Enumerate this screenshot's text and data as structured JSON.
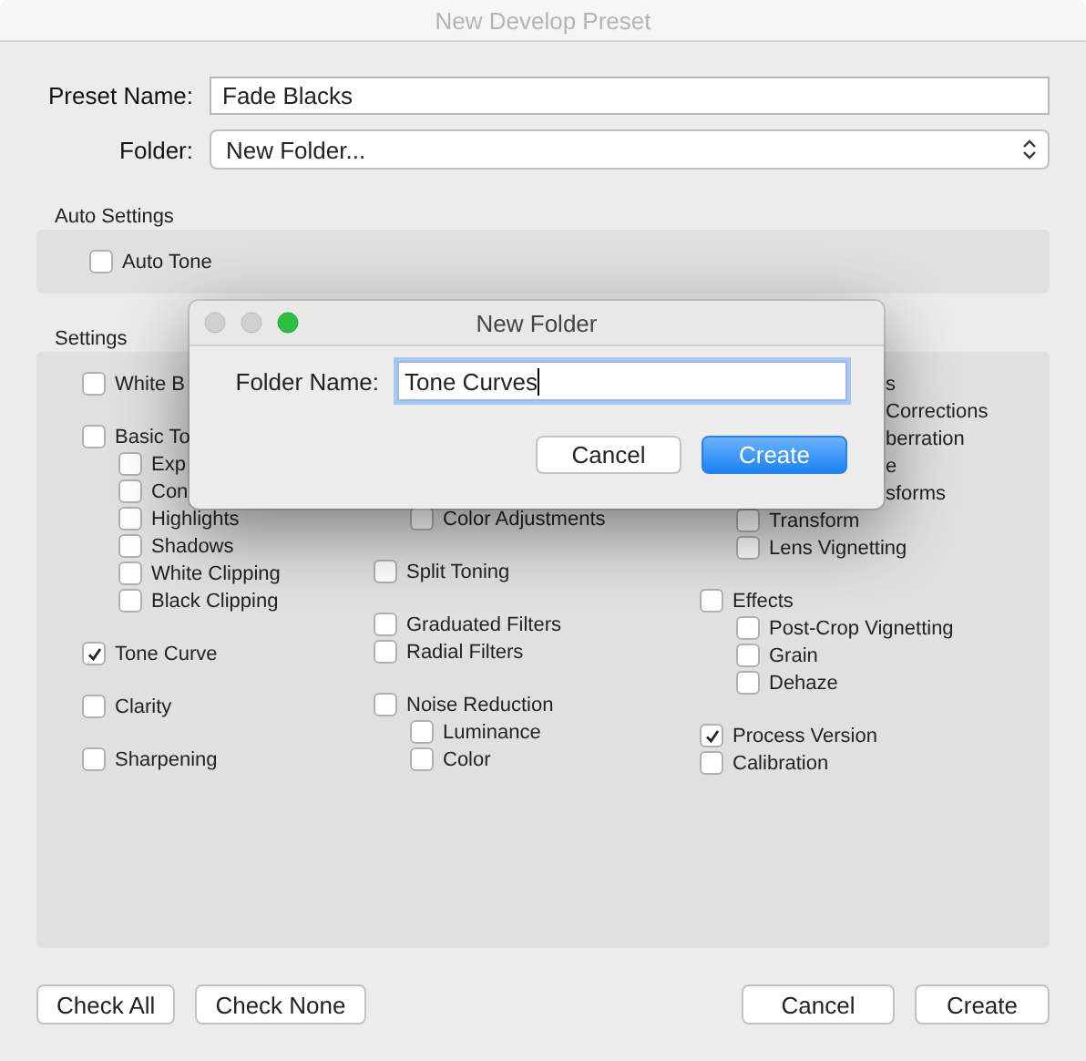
{
  "window": {
    "title": "New Develop Preset"
  },
  "preset_name": {
    "label": "Preset Name:",
    "value": "Fade Blacks"
  },
  "folder": {
    "label": "Folder:",
    "value": "New Folder..."
  },
  "auto_settings": {
    "title": "Auto Settings",
    "items": [
      {
        "label": "Auto Tone",
        "checked": false
      }
    ]
  },
  "settings": {
    "title": "Settings",
    "columns": [
      {
        "groups": [
          {
            "items": [
              {
                "kind": "checkbox",
                "label": "White B",
                "checked": false
              }
            ]
          },
          {
            "items": [
              {
                "kind": "checkbox",
                "label": "Basic To",
                "checked": false,
                "children": [
                  {
                    "kind": "checkbox",
                    "label": "Exp",
                    "checked": false
                  },
                  {
                    "kind": "checkbox",
                    "label": "Con",
                    "checked": false
                  },
                  {
                    "kind": "checkbox",
                    "label": "Highlights",
                    "checked": false
                  },
                  {
                    "kind": "checkbox",
                    "label": "Shadows",
                    "checked": false
                  },
                  {
                    "kind": "checkbox",
                    "label": "White Clipping",
                    "checked": false
                  },
                  {
                    "kind": "checkbox",
                    "label": "Black Clipping",
                    "checked": false
                  }
                ]
              }
            ]
          },
          {
            "items": [
              {
                "kind": "checkbox",
                "label": "Tone Curve",
                "checked": true
              }
            ]
          },
          {
            "items": [
              {
                "kind": "checkbox",
                "label": "Clarity",
                "checked": false
              }
            ]
          },
          {
            "items": [
              {
                "kind": "checkbox",
                "label": "Sharpening",
                "checked": false
              }
            ]
          }
        ]
      },
      {
        "groups": [
          {
            "items": [
              {
                "kind": "covered",
                "children": [
                  {
                    "kind": "checkbox",
                    "label": "Color Adjustments",
                    "checked": false
                  }
                ]
              }
            ]
          },
          {
            "items": [
              {
                "kind": "checkbox",
                "label": "Split Toning",
                "checked": false
              }
            ]
          },
          {
            "items": [
              {
                "kind": "checkbox",
                "label": "Graduated Filters",
                "checked": false
              },
              {
                "kind": "checkbox",
                "label": "Radial Filters",
                "checked": false
              }
            ]
          },
          {
            "items": [
              {
                "kind": "checkbox",
                "label": "Noise Reduction",
                "checked": false,
                "children": [
                  {
                    "kind": "checkbox",
                    "label": "Luminance",
                    "checked": false
                  },
                  {
                    "kind": "checkbox",
                    "label": "Color",
                    "checked": false
                  }
                ]
              }
            ]
          }
        ]
      },
      {
        "groups": [
          {
            "items": [
              {
                "kind": "fragment",
                "label": "s"
              },
              {
                "kind": "fragment",
                "label": "Corrections"
              },
              {
                "kind": "fragment",
                "label": "berration"
              },
              {
                "kind": "fragment",
                "label": "e"
              },
              {
                "kind": "fragment",
                "label": "sforms",
                "children": [
                  {
                    "kind": "checkbox",
                    "label": "Transform",
                    "checked": false
                  },
                  {
                    "kind": "checkbox",
                    "label": "Lens Vignetting",
                    "checked": false
                  }
                ]
              }
            ]
          },
          {
            "items": [
              {
                "kind": "checkbox",
                "label": "Effects",
                "checked": false,
                "children": [
                  {
                    "kind": "checkbox",
                    "label": "Post-Crop Vignetting",
                    "checked": false
                  },
                  {
                    "kind": "checkbox",
                    "label": "Grain",
                    "checked": false
                  },
                  {
                    "kind": "checkbox",
                    "label": "Dehaze",
                    "checked": false
                  }
                ]
              }
            ]
          },
          {
            "items": [
              {
                "kind": "checkbox",
                "label": "Process Version",
                "checked": true
              },
              {
                "kind": "checkbox",
                "label": "Calibration",
                "checked": false
              }
            ]
          }
        ]
      }
    ]
  },
  "buttons_left": [
    "Check All",
    "Check None"
  ],
  "buttons_right": [
    "Cancel",
    "Create"
  ],
  "dialog": {
    "title": "New Folder",
    "field_label": "Folder Name:",
    "value": "Tone Curves",
    "buttons": [
      {
        "label": "Cancel",
        "default": false
      },
      {
        "label": "Create",
        "default": true
      }
    ]
  }
}
